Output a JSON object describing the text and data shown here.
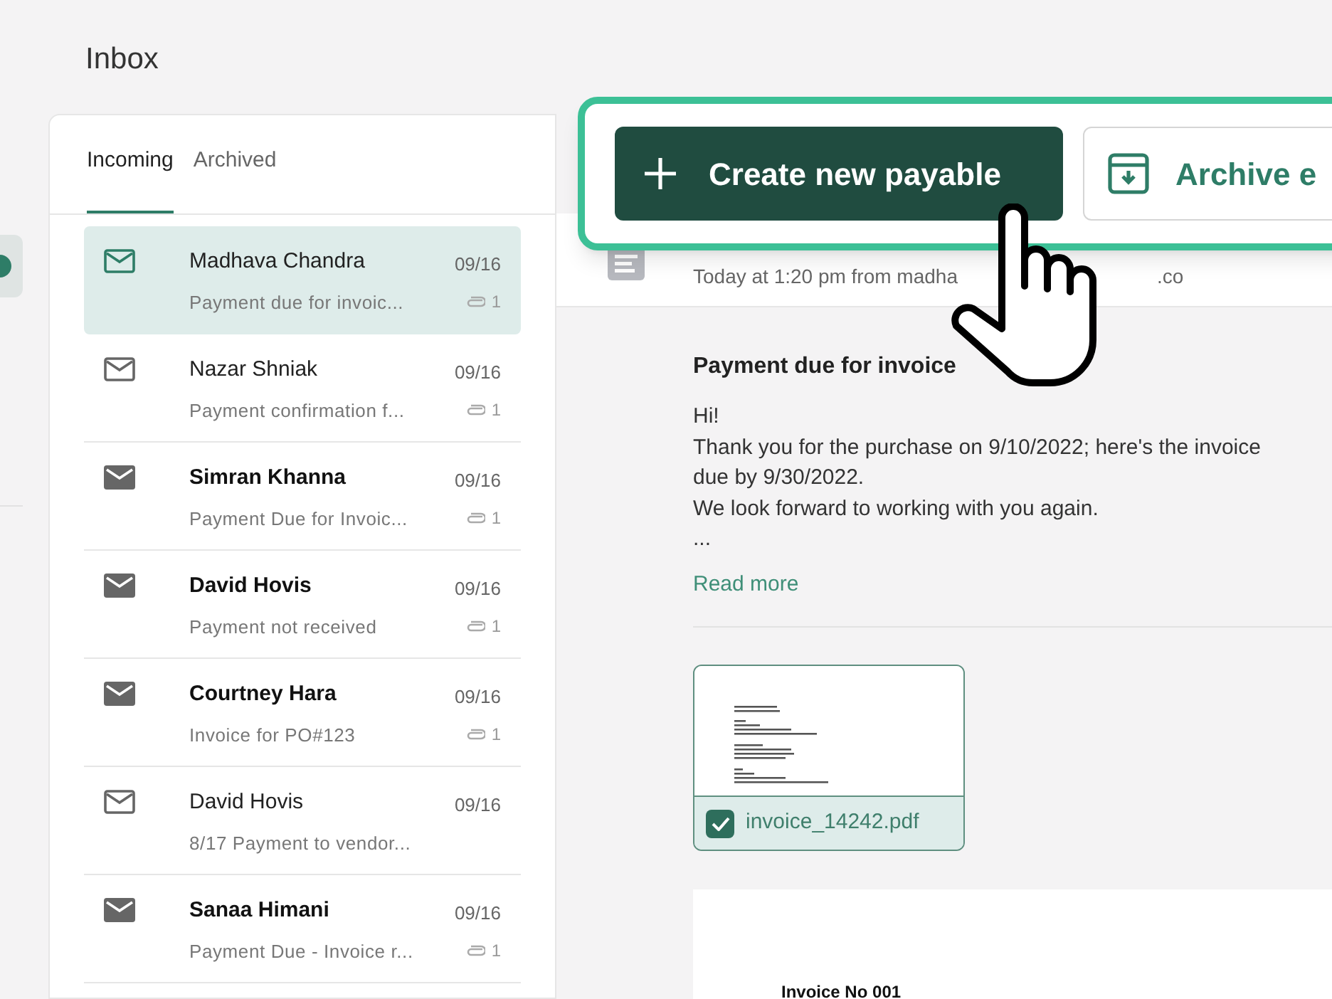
{
  "page_title": "Inbox",
  "tabs": [
    {
      "label": "Incoming",
      "selected": true
    },
    {
      "label": "Archived",
      "selected": false
    }
  ],
  "emails": [
    {
      "sender": "Madhava Chandra",
      "preview": "Payment due for invoic...",
      "date": "09/16",
      "attachments": "1",
      "unread": false,
      "selected": true
    },
    {
      "sender": "Nazar Shniak",
      "preview": "Payment confirmation f...",
      "date": "09/16",
      "attachments": "1",
      "unread": false,
      "selected": false
    },
    {
      "sender": "Simran Khanna",
      "preview": "Payment Due for Invoic...",
      "date": "09/16",
      "attachments": "1",
      "unread": true,
      "selected": false
    },
    {
      "sender": "David Hovis",
      "preview": "Payment not received",
      "date": "09/16",
      "attachments": "1",
      "unread": true,
      "selected": false
    },
    {
      "sender": "Courtney Hara",
      "preview": "Invoice for PO#123",
      "date": "09/16",
      "attachments": "1",
      "unread": true,
      "selected": false
    },
    {
      "sender": "David Hovis",
      "preview": "8/17 Payment to vendor...",
      "date": "09/16",
      "unread": false,
      "selected": false
    },
    {
      "sender": "Sanaa Himani",
      "preview": "Payment Due - Invoice r...",
      "date": "09/16",
      "attachments": "1",
      "unread": true,
      "selected": false
    }
  ],
  "message": {
    "meta_start": "Today at 1:20 pm from madha",
    "meta_end": ".co",
    "subject": "Payment due for invoice",
    "body": [
      "Hi!",
      "Thank you for the purchase on 9/10/2022; here's the invoice",
      "due by 9/30/2022.",
      "We look forward to working with you again.",
      "..."
    ],
    "read_more": "Read more",
    "attachment": {
      "filename": "invoice_14242.pdf",
      "checked": true
    },
    "preview_title": "Invoice No 001"
  },
  "actions": {
    "primary": "Create new payable",
    "secondary": "Archive e"
  }
}
